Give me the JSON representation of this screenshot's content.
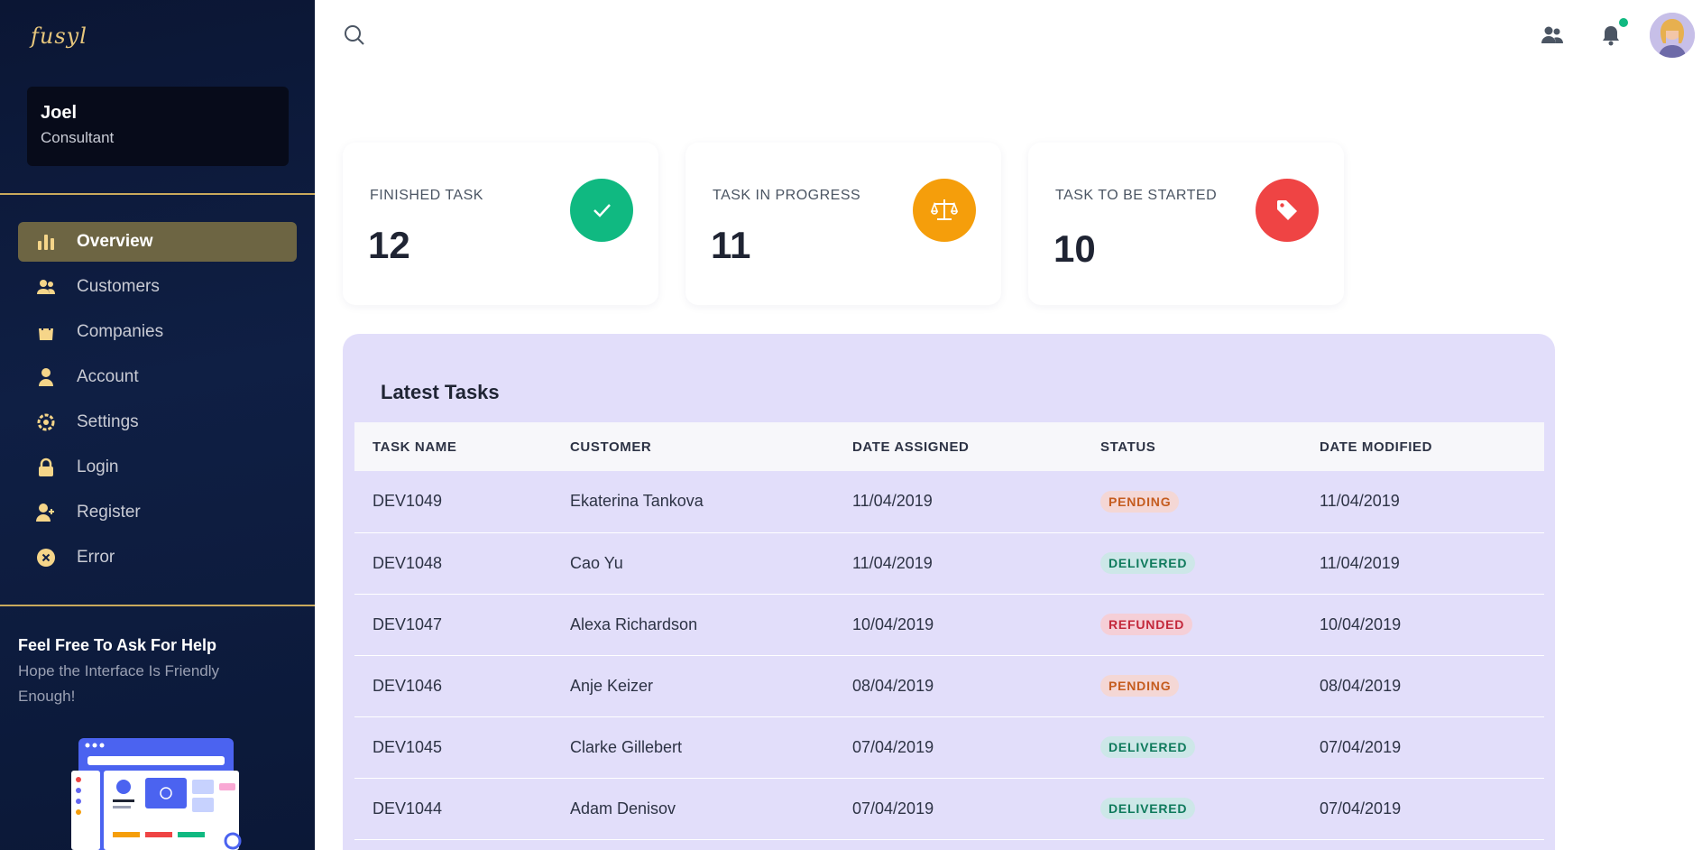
{
  "app": {
    "logo_text": "fusyl"
  },
  "user": {
    "name": "Joel",
    "role": "Consultant"
  },
  "nav": {
    "items": [
      {
        "label": "Overview",
        "icon": "bar-chart-icon",
        "active": true
      },
      {
        "label": "Customers",
        "icon": "users-icon",
        "active": false
      },
      {
        "label": "Companies",
        "icon": "shopping-bag-icon",
        "active": false
      },
      {
        "label": "Account",
        "icon": "user-icon",
        "active": false
      },
      {
        "label": "Settings",
        "icon": "gear-icon",
        "active": false
      },
      {
        "label": "Login",
        "icon": "lock-icon",
        "active": false
      },
      {
        "label": "Register",
        "icon": "user-plus-icon",
        "active": false
      },
      {
        "label": "Error",
        "icon": "x-circle-icon",
        "active": false
      }
    ]
  },
  "help": {
    "title": "Feel Free To Ask For Help",
    "subtitle": "Hope the Interface Is Friendly Enough!"
  },
  "topbar": {
    "icons": [
      "search-icon",
      "contacts-icon",
      "bell-icon",
      "avatar"
    ]
  },
  "stats": [
    {
      "label": "FINISHED TASK",
      "value": "12",
      "icon": "check-icon",
      "color": "#10b981"
    },
    {
      "label": "TASK IN PROGRESS",
      "value": "11",
      "icon": "scale-icon",
      "color": "#f59e0b"
    },
    {
      "label": "TASK TO BE STARTED",
      "value": "10",
      "icon": "tag-icon",
      "color": "#ef4444"
    }
  ],
  "tasks": {
    "title": "Latest Tasks",
    "columns": [
      "TASK NAME",
      "CUSTOMER",
      "DATE ASSIGNED",
      "STATUS",
      "DATE MODIFIED"
    ],
    "rows": [
      {
        "name": "DEV1049",
        "customer": "Ekaterina Tankova",
        "assigned": "11/04/2019",
        "status": "PENDING",
        "modified": "11/04/2019"
      },
      {
        "name": "DEV1048",
        "customer": "Cao Yu",
        "assigned": "11/04/2019",
        "status": "DELIVERED",
        "modified": "11/04/2019"
      },
      {
        "name": "DEV1047",
        "customer": "Alexa Richardson",
        "assigned": "10/04/2019",
        "status": "REFUNDED",
        "modified": "10/04/2019"
      },
      {
        "name": "DEV1046",
        "customer": "Anje Keizer",
        "assigned": "08/04/2019",
        "status": "PENDING",
        "modified": "08/04/2019"
      },
      {
        "name": "DEV1045",
        "customer": "Clarke Gillebert",
        "assigned": "07/04/2019",
        "status": "DELIVERED",
        "modified": "07/04/2019"
      },
      {
        "name": "DEV1044",
        "customer": "Adam Denisov",
        "assigned": "07/04/2019",
        "status": "DELIVERED",
        "modified": "07/04/2019"
      }
    ]
  },
  "colors": {
    "sidebar_bg": "#0f1f44",
    "accent_gold": "#c9a95c",
    "nav_active": "#6d6543",
    "panel_bg": "#e2defa"
  }
}
